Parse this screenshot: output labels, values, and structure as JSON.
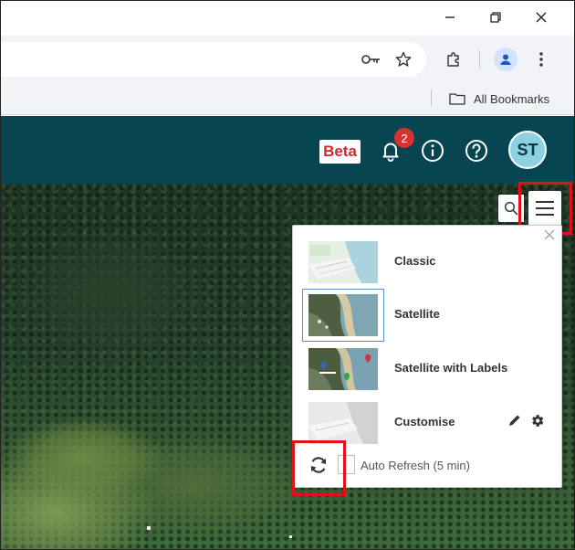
{
  "browser": {
    "window_controls": {
      "minimize": "—",
      "restore": "❐",
      "close": "✕"
    },
    "toolbar_icons": [
      "key-icon",
      "star-icon",
      "extensions-icon",
      "profile-icon",
      "more-icon"
    ],
    "bookmarks": {
      "all_bookmarks_label": "All Bookmarks"
    }
  },
  "header": {
    "beta_label": "Beta",
    "notification_count": "2",
    "avatar_initials": "ST",
    "colors": {
      "bar": "#074650",
      "beta_text": "#d6262f",
      "badge": "#d63232",
      "avatar": "#8dd0e1"
    }
  },
  "layer_panel": {
    "options": [
      {
        "label": "Classic",
        "selected": false
      },
      {
        "label": "Satellite",
        "selected": true
      },
      {
        "label": "Satellite with Labels",
        "selected": false
      },
      {
        "label": "Customise",
        "selected": false
      }
    ],
    "auto_refresh_label": "Auto Refresh (5 min)",
    "auto_refresh_checked": false
  },
  "highlight_color": "#e0111b"
}
